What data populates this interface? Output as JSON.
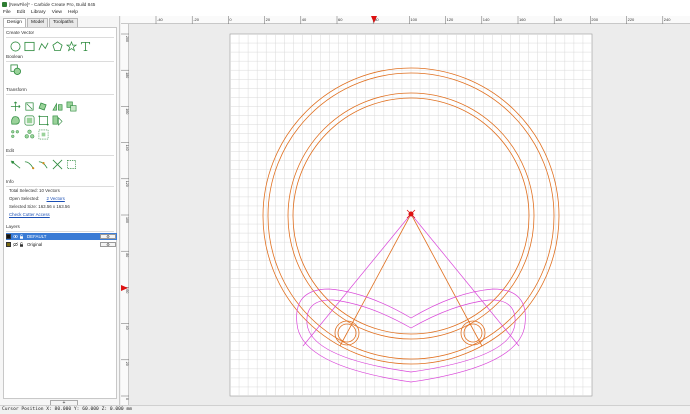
{
  "window": {
    "title": "[NewFile]* - Carbide Create Pro, Build 845"
  },
  "menu": [
    "File",
    "Edit",
    "Library",
    "View",
    "Help"
  ],
  "tabs": [
    {
      "label": "Design",
      "active": true
    },
    {
      "label": "Model",
      "active": false
    },
    {
      "label": "Toolpaths",
      "active": false
    }
  ],
  "sections": {
    "create_vector": "Create Vector",
    "boolean": "Boolean",
    "transform": "Transform",
    "edit": "Edit",
    "info": "Info",
    "layers": "Layers"
  },
  "tools": {
    "create_vector": [
      "circle-icon",
      "rectangle-icon",
      "polyline-icon",
      "polygon-icon",
      "star-icon",
      "text-icon"
    ],
    "boolean": [
      "boolean-union-icon"
    ],
    "transform": [
      "align-icon",
      "scale-icon",
      "rotate-icon",
      "mirror-icon",
      "offset-icon",
      "fillet-icon",
      "bounding-box-icon",
      "node-edit-icon",
      "array-icon",
      "duplicate-icon",
      "group-icon"
    ],
    "edit": [
      "trim-icon",
      "join-icon",
      "extend-icon",
      "cut-icon",
      "bounding-edit-icon"
    ]
  },
  "info": {
    "total_selected": "Total Selected:  10 Vectors",
    "open_selected_label": "Open Selected:",
    "open_selected_value": "2 Vectors",
    "selected_size": "Selected Size:   163.56 x 163.56",
    "check_cutter": "Check Cutter Access"
  },
  "layers": [
    {
      "name": "DEFAULT",
      "selected": true,
      "color": "#111111"
    },
    {
      "name": "Original",
      "selected": false,
      "color": "#7a6a10"
    }
  ],
  "add_layer_label": "+",
  "ruler": {
    "h_labels": [
      "-40",
      "-20",
      "0",
      "20",
      "40",
      "60",
      "80",
      "100",
      "120",
      "140",
      "160",
      "180",
      "200",
      "220",
      "240"
    ],
    "v_labels": [
      "200",
      "180",
      "160",
      "140",
      "120",
      "100",
      "80",
      "60",
      "40",
      "20",
      "0"
    ]
  },
  "colors": {
    "vector_selected": "#e07020",
    "vector_other": "#d946d9",
    "grid": "#d9d9d9",
    "origin_marker": "#dd1111",
    "layer_highlight": "#3a7bd5"
  },
  "status": {
    "cursor": "Cursor Position X: 80.000 Y: 60.000 Z: 0.000 mm"
  }
}
